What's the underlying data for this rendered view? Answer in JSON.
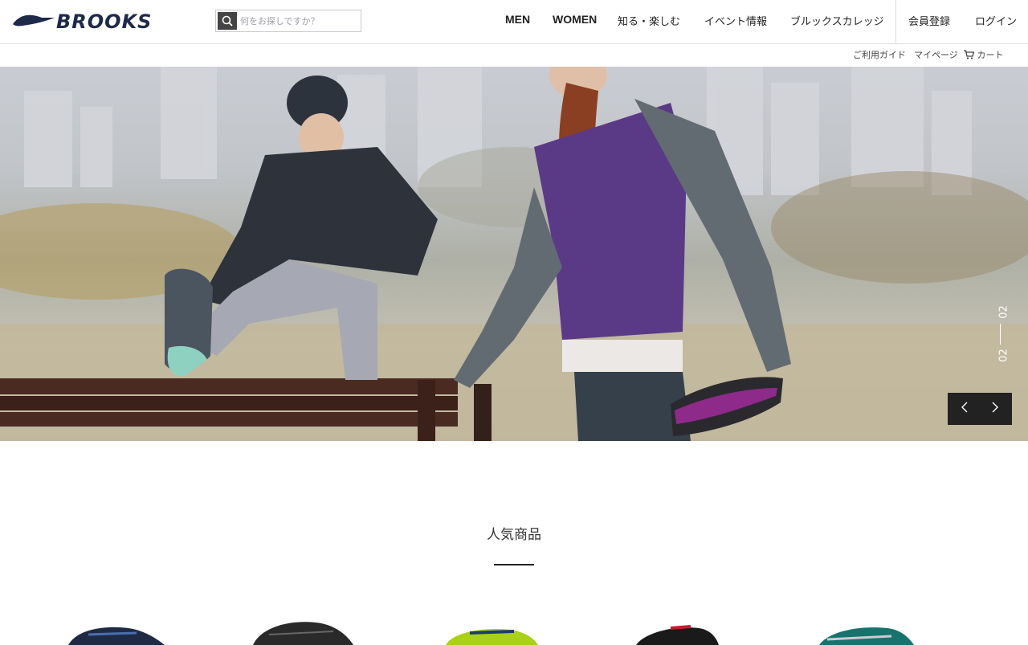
{
  "header": {
    "brand": "BROOKS",
    "search_placeholder": "何をお探しですか？",
    "nav": [
      "MEN",
      "WOMEN",
      "知る・楽しむ",
      "イベント情報",
      "ブルックスカレッジ",
      "会員登録",
      "ログイン"
    ],
    "utility": [
      "ご利用ガイド",
      "マイページ",
      "カート"
    ]
  },
  "hero": {
    "slide_current": "02",
    "slide_total": "02",
    "prev_arrow": "＜",
    "next_arrow": "＞"
  },
  "popular": {
    "title": "人気商品",
    "products": [
      {
        "name": "shoe-1",
        "color": "#1f2a44"
      },
      {
        "name": "shoe-2",
        "color": "#2a2a2a"
      },
      {
        "name": "shoe-3",
        "color": "#a9d117"
      },
      {
        "name": "shoe-4",
        "color": "#1a1a1a"
      },
      {
        "name": "shoe-5",
        "color": "#17736e"
      }
    ]
  },
  "colors": {
    "brand_navy": "#1e2a4a",
    "arrow_bg": "#222222",
    "vest_purple": "#5a3a86"
  }
}
